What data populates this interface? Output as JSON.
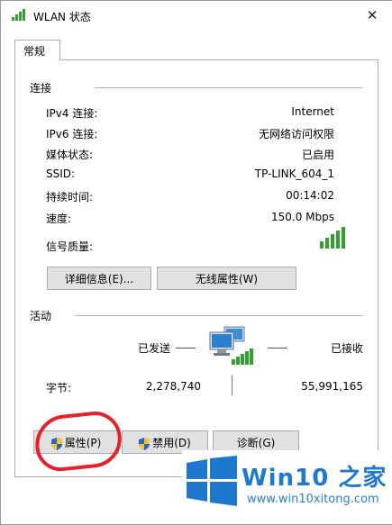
{
  "window": {
    "title": "WLAN 状态",
    "close_glyph": "✕"
  },
  "tabs": [
    {
      "label": "常规"
    }
  ],
  "connection": {
    "title": "连接",
    "rows": [
      {
        "label": "IPv4 连接:",
        "value": "Internet"
      },
      {
        "label": "IPv6 连接:",
        "value": "无网络访问权限"
      },
      {
        "label": "媒体状态:",
        "value": "已启用"
      },
      {
        "label": "SSID:",
        "value": "TP-LINK_604_1"
      },
      {
        "label": "持续时间:",
        "value": "00:14:02"
      },
      {
        "label": "速度:",
        "value": "150.0 Mbps"
      }
    ],
    "signal_label": "信号质量:",
    "signal_bars": 5,
    "details_button": "详细信息(E)...",
    "wireless_button": "无线属性(W)"
  },
  "activity": {
    "title": "活动",
    "sent_label": "已发送",
    "received_label": "已接收",
    "bytes_label": "字节:",
    "bytes_sent": "2,278,740",
    "bytes_received": "55,991,165"
  },
  "buttons": {
    "properties": "属性(P)",
    "disable": "禁用(D)",
    "diagnose": "诊断(G)"
  },
  "watermark": {
    "title": "Win10 之家",
    "url": "www.win10xitong.com"
  },
  "colors": {
    "signal": "#2fa22f",
    "annotation": "#e8202a",
    "logo": "#1e78d0"
  }
}
